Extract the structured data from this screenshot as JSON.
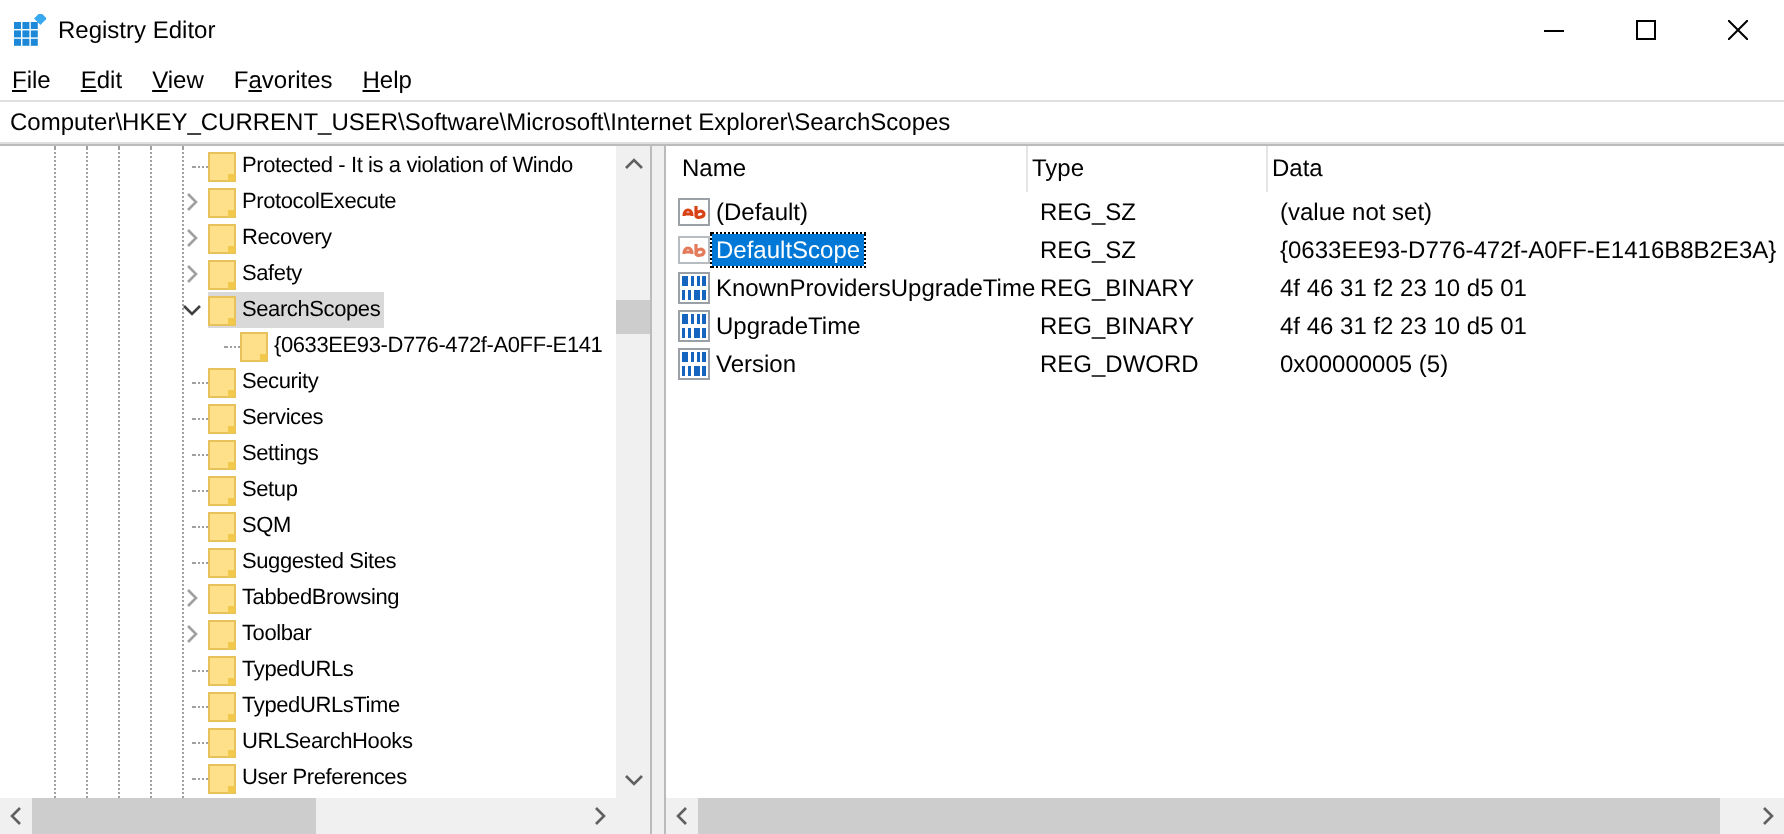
{
  "window": {
    "title": "Registry Editor"
  },
  "menu": [
    {
      "key": "F",
      "post": "ile"
    },
    {
      "key": "E",
      "post": "dit"
    },
    {
      "key": "V",
      "post": "iew"
    },
    {
      "pre": "F",
      "key": "a",
      "post": "vorites"
    },
    {
      "key": "H",
      "post": "elp"
    }
  ],
  "address": "Computer\\HKEY_CURRENT_USER\\Software\\Microsoft\\Internet Explorer\\SearchScopes",
  "tree": [
    {
      "label": "Protected - It is a violation of Windo",
      "has_children": false,
      "selected": false
    },
    {
      "label": "ProtocolExecute",
      "has_children": true,
      "expanded": false,
      "selected": false
    },
    {
      "label": "Recovery",
      "has_children": true,
      "expanded": false,
      "selected": false
    },
    {
      "label": "Safety",
      "has_children": true,
      "expanded": false,
      "selected": false
    },
    {
      "label": "SearchScopes",
      "has_children": true,
      "expanded": true,
      "selected": true,
      "children": [
        {
          "label": "{0633EE93-D776-472f-A0FF-E141",
          "has_children": false,
          "selected": false
        }
      ]
    },
    {
      "label": "Security",
      "has_children": false,
      "selected": false
    },
    {
      "label": "Services",
      "has_children": false,
      "selected": false
    },
    {
      "label": "Settings",
      "has_children": false,
      "selected": false
    },
    {
      "label": "Setup",
      "has_children": false,
      "selected": false
    },
    {
      "label": "SQM",
      "has_children": false,
      "selected": false
    },
    {
      "label": "Suggested Sites",
      "has_children": false,
      "selected": false
    },
    {
      "label": "TabbedBrowsing",
      "has_children": true,
      "expanded": false,
      "selected": false
    },
    {
      "label": "Toolbar",
      "has_children": true,
      "expanded": false,
      "selected": false
    },
    {
      "label": "TypedURLs",
      "has_children": false,
      "selected": false
    },
    {
      "label": "TypedURLsTime",
      "has_children": false,
      "selected": false
    },
    {
      "label": "URLSearchHooks",
      "has_children": false,
      "selected": false
    },
    {
      "label": "User Preferences",
      "has_children": false,
      "selected": false
    }
  ],
  "values": {
    "columns": [
      "Name",
      "Type",
      "Data"
    ],
    "rows": [
      {
        "kind": "string",
        "name": "(Default)",
        "type": "REG_SZ",
        "data": "(value not set)",
        "selected": false
      },
      {
        "kind": "string",
        "name": "DefaultScope",
        "type": "REG_SZ",
        "data": "{0633EE93-D776-472f-A0FF-E1416B8B2E3A}",
        "selected": true
      },
      {
        "kind": "binary",
        "name": "KnownProvidersUpgradeTime",
        "type": "REG_BINARY",
        "data": "4f 46 31 f2 23 10 d5 01",
        "selected": false
      },
      {
        "kind": "binary",
        "name": "UpgradeTime",
        "type": "REG_BINARY",
        "data": "4f 46 31 f2 23 10 d5 01",
        "selected": false
      },
      {
        "kind": "binary",
        "name": "Version",
        "type": "REG_DWORD",
        "data": "0x00000005 (5)",
        "selected": false
      }
    ]
  }
}
